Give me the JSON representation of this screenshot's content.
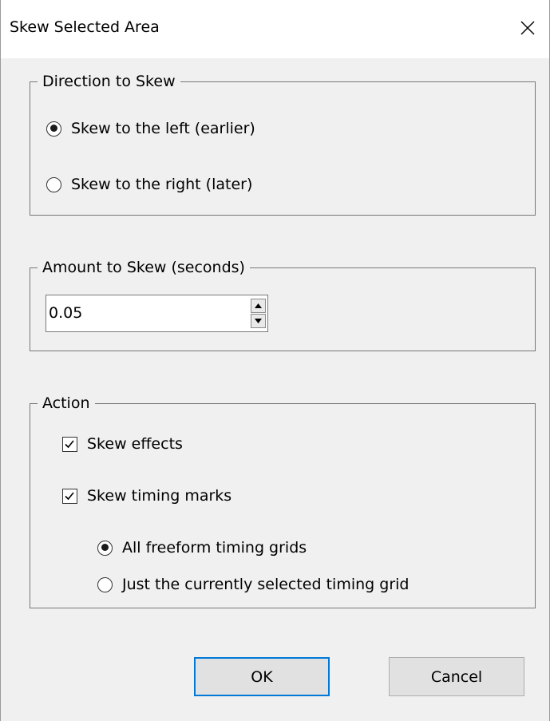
{
  "window": {
    "title": "Skew Selected Area"
  },
  "direction": {
    "legend": "Direction to Skew",
    "options": [
      {
        "label": "Skew to the left (earlier)",
        "checked": true
      },
      {
        "label": "Skew to the right (later)",
        "checked": false
      }
    ]
  },
  "amount": {
    "legend": "Amount to Skew (seconds)",
    "value": "0.05"
  },
  "action": {
    "legend": "Action",
    "skew_effects": {
      "label": "Skew effects",
      "checked": true
    },
    "skew_timing_marks": {
      "label": "Skew timing marks",
      "checked": true
    },
    "grid_options": [
      {
        "label": "All freeform timing grids",
        "checked": true
      },
      {
        "label": "Just the currently selected timing grid",
        "checked": false
      }
    ]
  },
  "buttons": {
    "ok": "OK",
    "cancel": "Cancel"
  },
  "icons": {
    "close": "close-icon",
    "spin_up": "spin-up-arrow-icon",
    "spin_down": "spin-down-arrow-icon",
    "checkmark": "checkmark-icon"
  },
  "colors": {
    "dialog_bg": "#f0f0f0",
    "titlebar_bg": "#ffffff",
    "default_button_border": "#0078d7",
    "button_bg": "#e1e1e1"
  }
}
